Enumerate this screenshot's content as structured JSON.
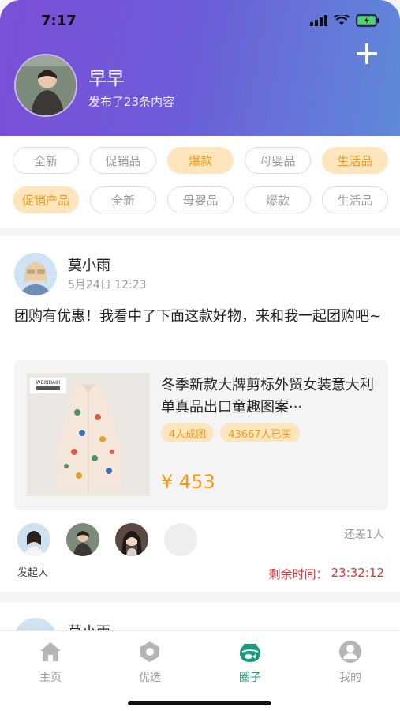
{
  "status_bar": {
    "time": "7:17"
  },
  "header": {
    "user_name": "早早",
    "subtitle": "发布了23条内容"
  },
  "tags": {
    "row1": [
      {
        "label": "全新",
        "active": false
      },
      {
        "label": "促销品",
        "active": false
      },
      {
        "label": "爆款",
        "active": true
      },
      {
        "label": "母婴品",
        "active": false
      },
      {
        "label": "生活品",
        "active": true
      }
    ],
    "row2": [
      {
        "label": "促销产品",
        "active": true
      },
      {
        "label": "全新",
        "active": false
      },
      {
        "label": "母婴品",
        "active": false
      },
      {
        "label": "爆款",
        "active": false
      },
      {
        "label": "生活品",
        "active": false
      }
    ]
  },
  "post": {
    "author": "莫小雨",
    "time": "5月24日 12:23",
    "text": "团购有优惠！我看中了下面这款好物，来和我一起团购吧~",
    "product": {
      "title": "冬季新款大牌剪标外贸女装意大利单真品出口童趣图案···",
      "badges": [
        "4人成团",
        "43667人已买"
      ],
      "price": "¥ 453"
    },
    "missing": "还差1人",
    "initiator_label": "发起人",
    "remaining_label": "剩余时间：",
    "remaining_time": "23:32:12"
  },
  "post2": {
    "author": "莫小雨"
  },
  "nav": {
    "items": [
      {
        "label": "主页",
        "icon": "home-icon",
        "active": false
      },
      {
        "label": "优选",
        "icon": "hexagon-icon",
        "active": false
      },
      {
        "label": "圈子",
        "icon": "fishbowl-icon",
        "active": true
      },
      {
        "label": "我的",
        "icon": "profile-icon",
        "active": false
      }
    ]
  },
  "colors": {
    "header_gradient": [
      "#7a4fd6",
      "#5f8ad9"
    ],
    "accent_orange": "#f09a1a",
    "tag_active_bg": "#fde6bd",
    "countdown_red": "#e53232",
    "nav_active": "#1c9a7a"
  }
}
